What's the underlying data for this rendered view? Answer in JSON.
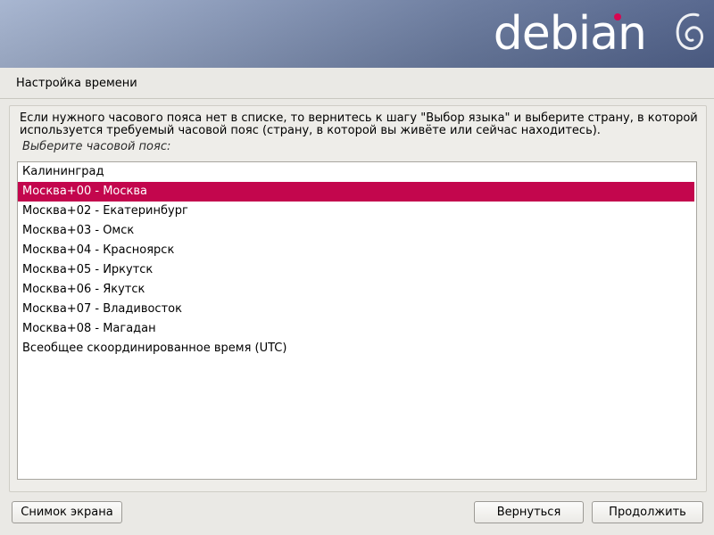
{
  "banner": {
    "logo_text": "debian",
    "logo_accent_color": "#d70751",
    "icon": "debian-swirl-icon"
  },
  "page": {
    "title": "Настройка времени"
  },
  "main": {
    "info_text": "Если нужного часового пояса нет в списке, то вернитесь к шагу \"Выбор языка\" и выберите страну, в которой используется требуемый часовой пояс (страну, в которой вы живёте или сейчас находитесь).",
    "prompt": "Выберите часовой пояс:",
    "selection_color": "#c3064d",
    "items": [
      "Калининград",
      "Москва+00 - Москва",
      "Москва+02 - Екатеринбург",
      "Москва+03 - Омск",
      "Москва+04 - Красноярск",
      "Москва+05 - Иркутск",
      "Москва+06 - Якутск",
      "Москва+07 - Владивосток",
      "Москва+08 - Магадан",
      "Всеобщее скоординированное время (UTC)"
    ],
    "selected": "Москва+00 - Москва"
  },
  "buttons": {
    "screenshot": "Снимок экрана",
    "back": "Вернуться",
    "continue": "Продолжить"
  }
}
